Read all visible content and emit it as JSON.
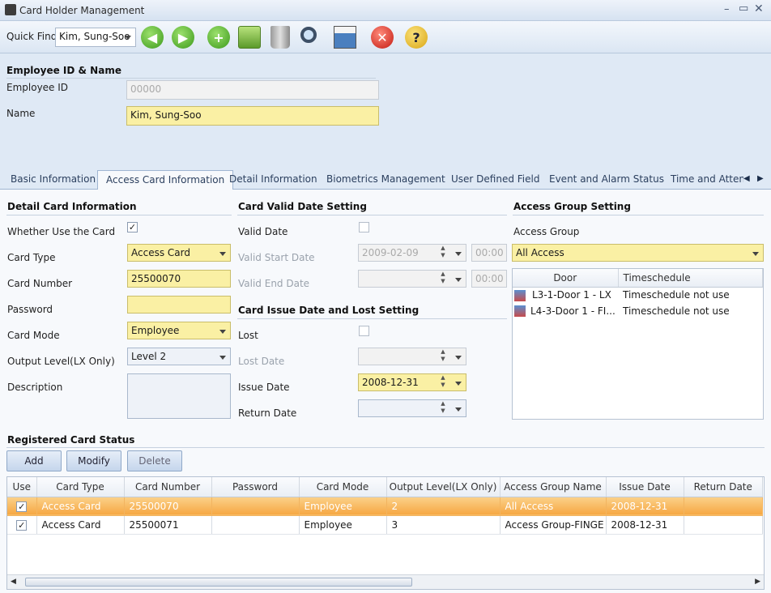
{
  "window": {
    "title": "Card Holder Management"
  },
  "toolbar": {
    "quick_find_label": "Quick Find",
    "quick_find_value": "Kim, Sung-Soo"
  },
  "employee": {
    "section_title": "Employee ID & Name",
    "id_label": "Employee ID",
    "id_value": "00000",
    "name_label": "Name",
    "name_value": "Kim, Sung-Soo"
  },
  "tabs": [
    {
      "label": "Basic Information"
    },
    {
      "label": "Access Card Information"
    },
    {
      "label": "Detail Information"
    },
    {
      "label": "Biometrics Management"
    },
    {
      "label": "User Defined Field"
    },
    {
      "label": "Event and Alarm Status"
    },
    {
      "label": "Time and Attend"
    }
  ],
  "detail": {
    "title": "Detail Card Information",
    "use_label": "Whether Use the Card",
    "use_checked": "✓",
    "type_label": "Card Type",
    "type_value": "Access Card",
    "number_label": "Card Number",
    "number_value": "25500070",
    "password_label": "Password",
    "mode_label": "Card Mode",
    "mode_value": "Employee",
    "output_label": "Output Level(LX Only)",
    "output_value": "Level 2",
    "desc_label": "Description"
  },
  "valid": {
    "title": "Card Valid Date Setting",
    "valid_label": "Valid Date",
    "start_label": "Valid Start Date",
    "start_value": "2009-02-09",
    "start_time": "00:00",
    "end_label": "Valid End Date",
    "end_time": "00:00"
  },
  "issue": {
    "title": "Card Issue Date and Lost Setting",
    "lost_label": "Lost",
    "lost_date_label": "Lost Date",
    "issue_label": "Issue Date",
    "issue_value": "2008-12-31",
    "return_label": "Return Date"
  },
  "access": {
    "title": "Access Group Setting",
    "group_label": "Access Group",
    "group_value": "All Access",
    "col_door": "Door",
    "col_schedule": "Timeschedule",
    "rows": [
      {
        "door": "L3-1-Door 1 - LX",
        "schedule": "Timeschedule not use"
      },
      {
        "door": "L4-3-Door 1 - FI...",
        "schedule": "Timeschedule not use"
      }
    ]
  },
  "registered": {
    "title": "Registered Card Status",
    "add": "Add",
    "modify": "Modify",
    "delete": "Delete",
    "columns": [
      "Use",
      "Card Type",
      "Card Number",
      "Password",
      "Card Mode",
      "Output Level(LX Only)",
      "Access Group Name",
      "Issue Date",
      "Return Date"
    ],
    "rows": [
      {
        "use": "✓",
        "type": "Access Card",
        "number": "25500070",
        "password": "",
        "mode": "Employee",
        "output": "2",
        "group": "All Access",
        "issue": "2008-12-31",
        "return": ""
      },
      {
        "use": "✓",
        "type": "Access Card",
        "number": "25500071",
        "password": "",
        "mode": "Employee",
        "output": "3",
        "group": "Access Group-FINGE",
        "issue": "2008-12-31",
        "return": ""
      }
    ]
  }
}
